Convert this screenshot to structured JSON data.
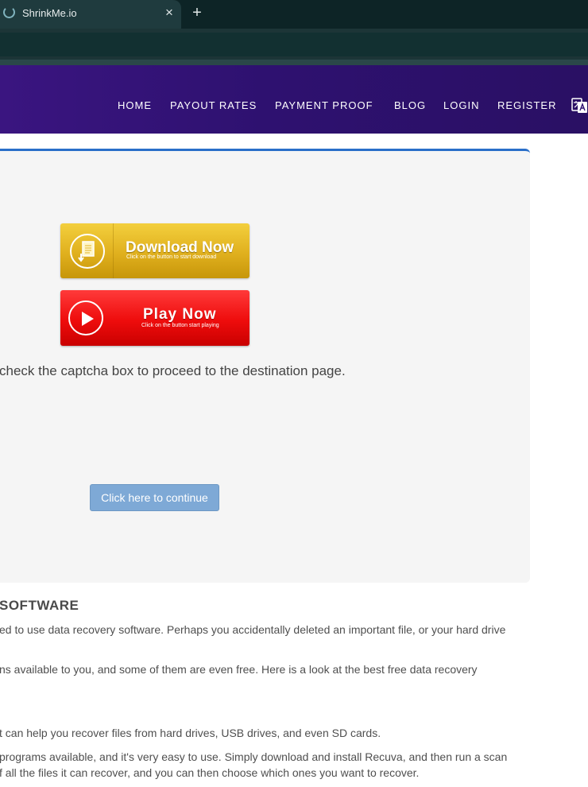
{
  "browser": {
    "tab_title": "ShrinkMe.io",
    "tab_close": "×",
    "new_tab": "+"
  },
  "nav": {
    "items": [
      "HOME",
      "PAYOUT RATES",
      "PAYMENT PROOF",
      "BLOG",
      "LOGIN",
      "REGISTER"
    ]
  },
  "ads": {
    "download": {
      "title": "Download Now",
      "subtitle": "Click on the button to start download"
    },
    "play": {
      "title": "Play Now",
      "subtitle": "Click on the button start playing"
    }
  },
  "main": {
    "captcha_message": "check the captcha box to proceed to the destination page.",
    "continue_label": "Click here to continue"
  },
  "article": {
    "heading": "SOFTWARE",
    "paragraphs": [
      "ed to use data recovery software. Perhaps you accidentally deleted an important file, or your hard drive",
      "ns available to you, and some of them are even free. Here is a look at the best free data recovery",
      "t can help you recover files from hard drives, USB drives, and even SD cards.",
      "programs available, and it's very easy to use. Simply download and install Recuva, and then run a scan",
      "f all the files it can recover, and you can then choose which ones you want to recover."
    ]
  },
  "colors": {
    "nav_bg": "#2e1170",
    "panel_bg": "#f5f5f5",
    "panel_accent": "#2a6fc9",
    "continue_button": "#7ea9d6"
  }
}
